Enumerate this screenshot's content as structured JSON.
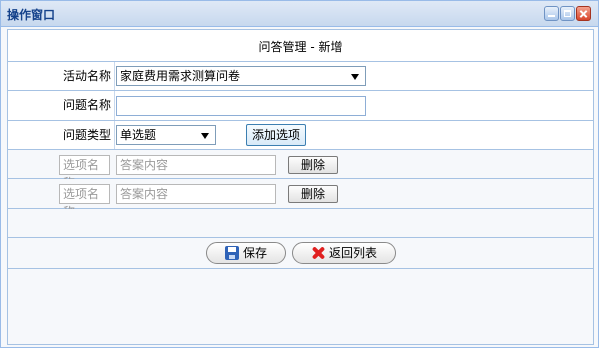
{
  "window": {
    "title": "操作窗口"
  },
  "form": {
    "heading": "问答管理 - 新增",
    "activity_label": "活动名称",
    "activity_value": "家庭费用需求测算问卷",
    "question_name_label": "问题名称",
    "question_name_value": "",
    "question_type_label": "问题类型",
    "question_type_value": "单选题",
    "add_option_label": "添加选项",
    "options": [
      {
        "name_placeholder": "选项名称",
        "answer_placeholder": "答案内容",
        "delete_label": "删除"
      },
      {
        "name_placeholder": "选项名称",
        "answer_placeholder": "答案内容",
        "delete_label": "删除"
      }
    ]
  },
  "actions": {
    "save_label": "保存",
    "back_label": "返回列表"
  },
  "colors": {
    "border": "#a6c2e3",
    "title_text": "#15428b",
    "close_button": "#d8442a",
    "save_icon": "#2f63b8",
    "back_icon": "#e02020"
  }
}
